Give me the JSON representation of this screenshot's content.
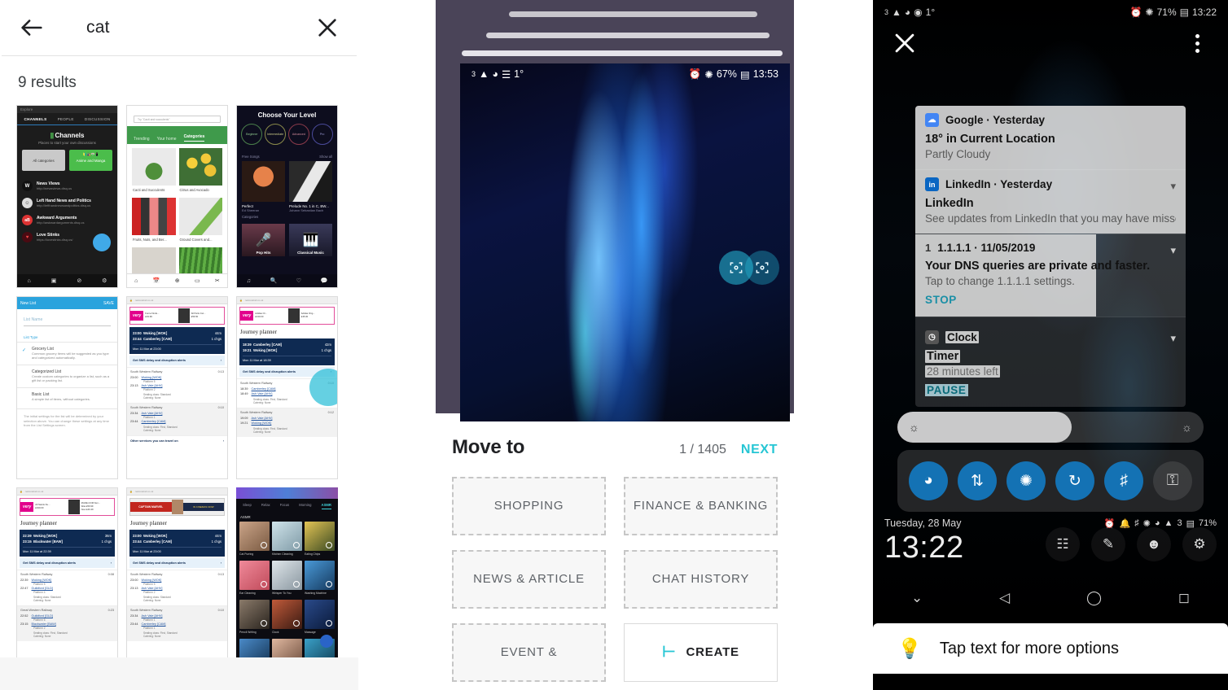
{
  "search_panel": {
    "back_icon": "back-arrow-icon",
    "query": "cat",
    "clear_icon": "close-icon",
    "results_label": "9 results",
    "thumbnails": [
      {
        "app": "disqus-channels",
        "header": "Explore",
        "tabs": [
          "CHANNELS",
          "PEOPLE",
          "DISCUSSION"
        ],
        "title": "Channels",
        "subtitle": "Places to start your own discussions",
        "chips": [
          "All categories",
          "Anime and Manga"
        ],
        "channels": [
          {
            "name": "News Views",
            "url": "http://newsviews.disq.us",
            "badge": "W"
          },
          {
            "name": "Left Hand News and Politics",
            "url": "http://lefthandnewsandpolitics.disq.us",
            "badge": "☺"
          },
          {
            "name": "Awkward Arguments",
            "url": "http://awkwardarguments.disq.us",
            "badge": "aB"
          },
          {
            "name": "Love Stinks",
            "url": "https://lovestinks.disq.us/",
            "badge": "♥"
          }
        ],
        "nav": [
          "⌂",
          "▣",
          "⊘",
          "⚙"
        ]
      },
      {
        "app": "plants-categories",
        "search_placeholder": "Try \"Cacti and succulents\"",
        "tabs": [
          "Trending",
          "Your home",
          "Categories"
        ],
        "cards": [
          "Cacti and Succulents",
          "Citrus and Avocado",
          "Fruits, Nuts, and Ber...",
          "Ground Covers and..."
        ],
        "nav": [
          "⌂",
          "Ὄ5",
          "⊕",
          "▭",
          "✂"
        ]
      },
      {
        "app": "music-learning",
        "title": "Choose Your Level",
        "levels": [
          "Beginner",
          "Intermediate",
          "Advanced",
          "Pro"
        ],
        "section_free": "Free Songs",
        "show_all": "Show all",
        "songs": [
          {
            "title": "Perfect",
            "artist": "Ed Sheeran"
          },
          {
            "title": "Prelude No. 1 in C, BW...",
            "artist": "Johann Sebastian Bach"
          }
        ],
        "section_categories": "Categories",
        "categories": [
          "Pop Hits",
          "Classical Music"
        ],
        "nav": [
          "♫",
          "ὐd",
          "♡",
          "Ὂc"
        ]
      },
      {
        "app": "new-list",
        "appbar_title": "New List",
        "appbar_action": "SAVE",
        "field_label": "List Name",
        "type_label": "List Type",
        "options": [
          {
            "title": "Grocery List",
            "desc": "Common grocery items will be suggested as you type and categorized automatically.",
            "checked": true
          },
          {
            "title": "Categorized List",
            "desc": "Create custom categories to organize a list, such as a gift list or packing list.",
            "checked": false
          },
          {
            "title": "Basic List",
            "desc": "A simple list of items, without categories.",
            "checked": false
          }
        ],
        "note": "The initial settings for the list will be determined by your selection above. You can change these settings at any time from the List Settings screen."
      },
      {
        "app": "journey-planner-a",
        "ad": {
          "brand": "very",
          "left_title": "Force Finds...",
          "left_price": "£19.99",
          "right_title": "All Paris Cut...",
          "right_price": "£56.50"
        },
        "hero": {
          "from_time": "23:00",
          "from_station": "Woking [WOK]",
          "to_time": "23:44",
          "to_station": "Camberley [CAM]",
          "duration": "44m",
          "changes": "1 chgs",
          "date": "Mon 11 Mar at 23:00"
        },
        "sms": "Get SMS delay and disruption alerts",
        "legs": [
          {
            "operator": "South Western Railway",
            "dur": "0:13",
            "from_time": "23:00",
            "from": "Woking [WOK]",
            "from_platform": "Platform 5",
            "to_time": "23:13",
            "to": "Ash Vale [AHV]",
            "to_platform": "Platform 2",
            "seating": "Standard",
            "catering": "None"
          },
          {
            "operator": "South Western Railway",
            "dur": "0:10",
            "from_time": "23:34",
            "from": "Ash Vale [AHV]",
            "from_platform": "Platform 1",
            "to_time": "23:44",
            "to": "Camberley [CAM]",
            "to_platform": "",
            "seating": "First, Standard",
            "catering": "None"
          }
        ],
        "other": "Other services you can travel on"
      },
      {
        "app": "journey-planner-b",
        "ad": {
          "brand": "very",
          "left_title": "Adidas Or...",
          "left_price": "£130.00",
          "right_title": "Adidas Orig...",
          "right_price": "£45.00"
        },
        "title": "Journey planner",
        "hero": {
          "from_time": "18:39",
          "from_station": "Camberley [CAM]",
          "to_time": "19:21",
          "to_station": "Woking [WOK]",
          "duration": "42m",
          "changes": "1 chgs",
          "date": "Mon 11 Mar at 18:39"
        },
        "sms": "Get SMS delay and disruption alerts",
        "legs": [
          {
            "operator": "South Western Railway",
            "dur": "0:10",
            "from_time": "18:39",
            "from": "Camberley [CAM]",
            "to_time": "18:49",
            "to": "Ash Vale [AHV]",
            "seating": "First, Standard",
            "catering": "None"
          },
          {
            "operator": "South Western Railway",
            "dur": "0:12",
            "from_time": "19:09",
            "from": "Ash Vale [AHV]",
            "to_time": "19:21",
            "to": "Woking [WOK]",
            "seating": "First, Standard",
            "catering": "None"
          }
        ]
      },
      {
        "app": "journey-planner-c",
        "ad": {
          "brand": "very",
          "left_title": "All Saints Ku...",
          "left_price": "£190.00",
          "right_title": "MADE.COM Ken...",
          "right_price_was": "Was £59.99",
          "right_price_now": "Now £40.49"
        },
        "title": "Journey planner",
        "hero": {
          "from_time": "22:39",
          "from_station": "Woking [WOK]",
          "to_time": "23:15",
          "to_station": "Blackwater [BAW]",
          "duration": "36m",
          "changes": "1 chgs",
          "date": "Mon 11 Mar at 22:39"
        },
        "sms": "Get SMS delay and disruption alerts",
        "legs": [
          {
            "operator": "South Western Railway",
            "dur": "0:08",
            "from_time": "22:39",
            "from": "Woking [WOK]",
            "from_platform": "Platform 5",
            "to_time": "22:47",
            "to": "Guildford [GLD]",
            "to_platform": "Platform 4",
            "seating": "Standard",
            "catering": "None"
          },
          {
            "operator": "Great Western Railway",
            "dur": "0:23",
            "from_time": "22:52",
            "from": "Guildford [GLD]",
            "from_platform": "Platform 6",
            "to_time": "23:15",
            "to": "Blackwater [BAW]",
            "to_platform": "Platform 2",
            "seating": "First, Standard",
            "catering": "None"
          }
        ]
      },
      {
        "app": "journey-planner-d",
        "ad": {
          "brand": "MARVEL",
          "campaign": "CAPTAIN MARVEL",
          "right_title": "IN CINEMAS NOW"
        },
        "title": "Journey planner",
        "hero": {
          "from_time": "23:00",
          "from_station": "Woking [WOK]",
          "to_time": "23:44",
          "to_station": "Camberley [CAM]",
          "duration": "44m",
          "changes": "1 chgs",
          "date": "Mon 11 Mar at 23:00"
        },
        "sms": "Get SMS delay and disruption alerts",
        "legs": [
          {
            "operator": "South Western Railway",
            "dur": "0:13",
            "from_time": "23:00",
            "from": "Woking [WOK]",
            "from_platform": "Platform 5",
            "to_time": "23:13",
            "to": "Ash Vale [AHV]",
            "to_platform": "Platform 2",
            "seating": "Standard",
            "catering": "None"
          },
          {
            "operator": "South Western Railway",
            "dur": "0:10",
            "from_time": "23:34",
            "from": "Ash Vale [AHV]",
            "from_platform": "Platform 1",
            "to_time": "23:44",
            "to": "Camberley [CAM]",
            "to_platform": "Platform 1",
            "seating": "First, Standard",
            "catering": "None"
          }
        ]
      },
      {
        "app": "asmr-sounds",
        "tabs": [
          "Sleep",
          "Relax",
          "Focus",
          "Morning",
          "ASMR"
        ],
        "section": "ASMR",
        "tiles": [
          "Cat Purring",
          "Kitchen Cleaning",
          "Eating Chips",
          "Ear Cleaning",
          "Whisper To You",
          "Washing Machine",
          "Pencil Writing",
          "Clock",
          "Massage"
        ],
        "nav": [
          "♫",
          "☺",
          "☰"
        ]
      }
    ]
  },
  "move_panel": {
    "status": {
      "sim": "3",
      "signal_icon": "signal-bars-icon",
      "wifi_icon": "wifi-icon",
      "mute_icon": "mute-icon",
      "temp": "1°",
      "alarm_icon": "alarm-icon",
      "bt_icon": "bluetooth-icon",
      "battery": "67%",
      "battery_icon": "battery-icon",
      "time": "13:53"
    },
    "fab_icons": [
      "lens-scan-icon",
      "lens-scan-icon"
    ],
    "sheet": {
      "title": "Move to",
      "counter": "1 / 1405",
      "next_label": "NEXT",
      "next_color": "#26c6d4",
      "categories": [
        "SHOPPING",
        "FINANCE & BANKING",
        "NEWS & ARTICLE",
        "CHAT HISTORY",
        "EVENT &"
      ],
      "create_label": "CREATE",
      "create_icon": "create-folder-icon"
    }
  },
  "shade_panel": {
    "status": {
      "sim": "3",
      "signal_icon": "signal-bars-icon",
      "wifi_icon": "wifi-icon",
      "dnd_icon": "dnd-icon",
      "temp": "1°",
      "alarm_icon": "alarm-icon",
      "bt_icon": "bluetooth-icon",
      "battery": "71%",
      "battery_icon": "battery-icon",
      "time": "13:22"
    },
    "close_icon": "close-icon",
    "overflow_icon": "kebab-menu-icon",
    "notifications": [
      {
        "app": "Google",
        "when": "Yesterday",
        "icon": "google-weather-icon",
        "icon_color": "#4285f4",
        "title": "18° in Current Location",
        "body": "Partly Cloudy",
        "action": "",
        "expand": false,
        "style": "light"
      },
      {
        "app": "LinkedIn",
        "when": "Yesterday",
        "icon": "linkedin-icon",
        "icon_color": "#0a66c2",
        "icon_text": "in",
        "title": "LinkedIn",
        "body": "See updates from LinkedIn that you may have missed",
        "action": "",
        "expand": true,
        "style": "light"
      },
      {
        "app": "1.1.1.1",
        "when": "11/05/2019",
        "icon": "one-one-one-one-icon",
        "icon_text": "1",
        "title": "Your DNS queries are private and faster.",
        "body": "Tap to change 1.1.1.1 settings.",
        "action": "STOP",
        "action_color": "#1a8fa6",
        "expand": true,
        "style": "light"
      },
      {
        "app": "Clock",
        "when": "",
        "icon": "clock-icon",
        "title": "Timer",
        "body": "28 minutes left",
        "action": "PAUSE",
        "action_color": "#1a8fa6",
        "expand": true,
        "style": "dark",
        "highlighted": true
      }
    ],
    "brightness": {
      "left_icon": "brightness-low-icon",
      "right_icon": "brightness-high-icon",
      "value_percent": 57
    },
    "toggles": [
      {
        "name": "wifi-toggle",
        "icon": "wifi-icon",
        "on": true
      },
      {
        "name": "mobile-data-toggle",
        "icon": "data-arrows-icon",
        "on": true
      },
      {
        "name": "bluetooth-toggle",
        "icon": "bluetooth-icon",
        "on": true
      },
      {
        "name": "auto-rotate-toggle",
        "icon": "rotate-icon",
        "on": true
      },
      {
        "name": "location-toggle",
        "icon": "location-pin-icon",
        "on": true
      },
      {
        "name": "screen-lock-toggle",
        "icon": "lock-rotate-icon",
        "on": false
      }
    ],
    "clock": {
      "date": "Tuesday, 28 May",
      "time": "13:22",
      "tray_icons": [
        "alarm-icon",
        "bell-icon",
        "location-pin-icon",
        "bluetooth-icon",
        "wifi-icon",
        "signal-bars-icon",
        "sim-3-icon",
        "battery-icon"
      ],
      "battery": "71%"
    },
    "home_shortcuts": [
      "app-drawer-icon",
      "pen-icon",
      "contact-icon",
      "settings-gear-icon"
    ],
    "navbar": [
      "chevron-down-icon",
      "back-triangle-icon",
      "home-circle-icon",
      "recents-square-icon"
    ],
    "tip": {
      "icon": "lightbulb-icon",
      "text": "Tap text for more options"
    }
  }
}
